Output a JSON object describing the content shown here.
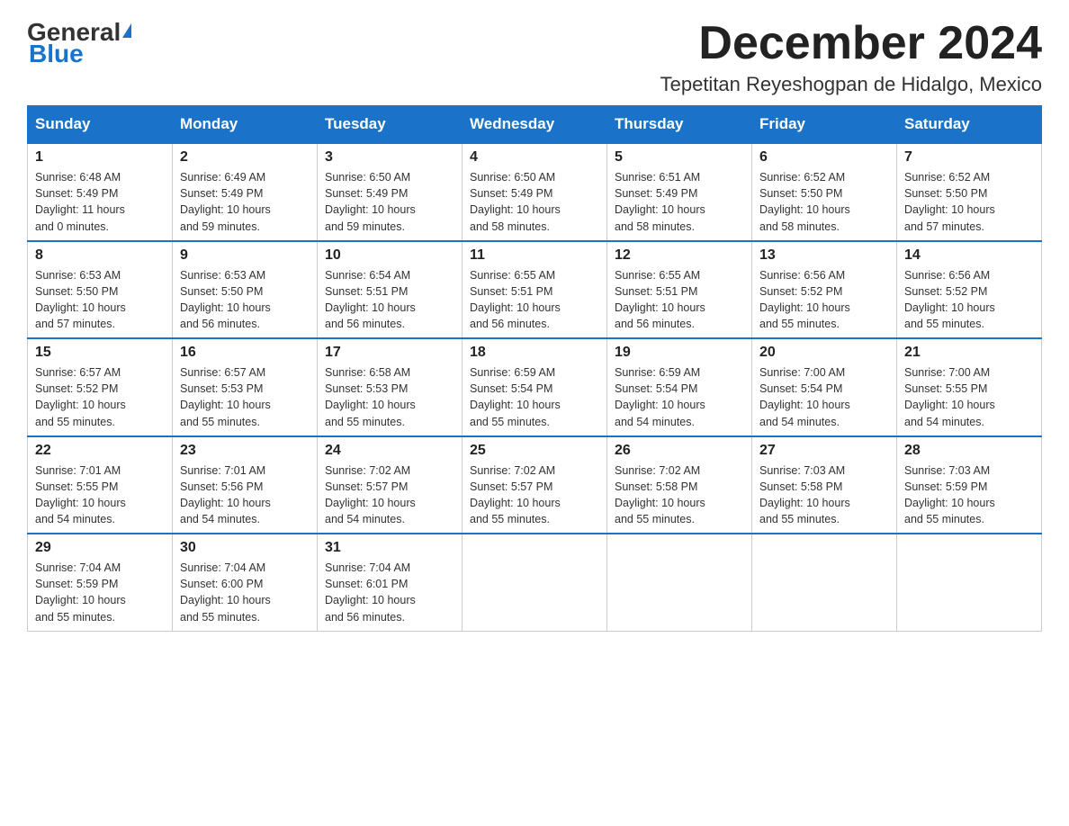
{
  "header": {
    "logo_general": "General",
    "logo_blue": "Blue",
    "month_title": "December 2024",
    "location": "Tepetitan Reyeshogpan de Hidalgo, Mexico"
  },
  "days_of_week": [
    "Sunday",
    "Monday",
    "Tuesday",
    "Wednesday",
    "Thursday",
    "Friday",
    "Saturday"
  ],
  "weeks": [
    [
      {
        "day": "1",
        "sunrise": "6:48 AM",
        "sunset": "5:49 PM",
        "daylight": "11 hours and 0 minutes."
      },
      {
        "day": "2",
        "sunrise": "6:49 AM",
        "sunset": "5:49 PM",
        "daylight": "10 hours and 59 minutes."
      },
      {
        "day": "3",
        "sunrise": "6:50 AM",
        "sunset": "5:49 PM",
        "daylight": "10 hours and 59 minutes."
      },
      {
        "day": "4",
        "sunrise": "6:50 AM",
        "sunset": "5:49 PM",
        "daylight": "10 hours and 58 minutes."
      },
      {
        "day": "5",
        "sunrise": "6:51 AM",
        "sunset": "5:49 PM",
        "daylight": "10 hours and 58 minutes."
      },
      {
        "day": "6",
        "sunrise": "6:52 AM",
        "sunset": "5:50 PM",
        "daylight": "10 hours and 58 minutes."
      },
      {
        "day": "7",
        "sunrise": "6:52 AM",
        "sunset": "5:50 PM",
        "daylight": "10 hours and 57 minutes."
      }
    ],
    [
      {
        "day": "8",
        "sunrise": "6:53 AM",
        "sunset": "5:50 PM",
        "daylight": "10 hours and 57 minutes."
      },
      {
        "day": "9",
        "sunrise": "6:53 AM",
        "sunset": "5:50 PM",
        "daylight": "10 hours and 56 minutes."
      },
      {
        "day": "10",
        "sunrise": "6:54 AM",
        "sunset": "5:51 PM",
        "daylight": "10 hours and 56 minutes."
      },
      {
        "day": "11",
        "sunrise": "6:55 AM",
        "sunset": "5:51 PM",
        "daylight": "10 hours and 56 minutes."
      },
      {
        "day": "12",
        "sunrise": "6:55 AM",
        "sunset": "5:51 PM",
        "daylight": "10 hours and 56 minutes."
      },
      {
        "day": "13",
        "sunrise": "6:56 AM",
        "sunset": "5:52 PM",
        "daylight": "10 hours and 55 minutes."
      },
      {
        "day": "14",
        "sunrise": "6:56 AM",
        "sunset": "5:52 PM",
        "daylight": "10 hours and 55 minutes."
      }
    ],
    [
      {
        "day": "15",
        "sunrise": "6:57 AM",
        "sunset": "5:52 PM",
        "daylight": "10 hours and 55 minutes."
      },
      {
        "day": "16",
        "sunrise": "6:57 AM",
        "sunset": "5:53 PM",
        "daylight": "10 hours and 55 minutes."
      },
      {
        "day": "17",
        "sunrise": "6:58 AM",
        "sunset": "5:53 PM",
        "daylight": "10 hours and 55 minutes."
      },
      {
        "day": "18",
        "sunrise": "6:59 AM",
        "sunset": "5:54 PM",
        "daylight": "10 hours and 55 minutes."
      },
      {
        "day": "19",
        "sunrise": "6:59 AM",
        "sunset": "5:54 PM",
        "daylight": "10 hours and 54 minutes."
      },
      {
        "day": "20",
        "sunrise": "7:00 AM",
        "sunset": "5:54 PM",
        "daylight": "10 hours and 54 minutes."
      },
      {
        "day": "21",
        "sunrise": "7:00 AM",
        "sunset": "5:55 PM",
        "daylight": "10 hours and 54 minutes."
      }
    ],
    [
      {
        "day": "22",
        "sunrise": "7:01 AM",
        "sunset": "5:55 PM",
        "daylight": "10 hours and 54 minutes."
      },
      {
        "day": "23",
        "sunrise": "7:01 AM",
        "sunset": "5:56 PM",
        "daylight": "10 hours and 54 minutes."
      },
      {
        "day": "24",
        "sunrise": "7:02 AM",
        "sunset": "5:57 PM",
        "daylight": "10 hours and 54 minutes."
      },
      {
        "day": "25",
        "sunrise": "7:02 AM",
        "sunset": "5:57 PM",
        "daylight": "10 hours and 55 minutes."
      },
      {
        "day": "26",
        "sunrise": "7:02 AM",
        "sunset": "5:58 PM",
        "daylight": "10 hours and 55 minutes."
      },
      {
        "day": "27",
        "sunrise": "7:03 AM",
        "sunset": "5:58 PM",
        "daylight": "10 hours and 55 minutes."
      },
      {
        "day": "28",
        "sunrise": "7:03 AM",
        "sunset": "5:59 PM",
        "daylight": "10 hours and 55 minutes."
      }
    ],
    [
      {
        "day": "29",
        "sunrise": "7:04 AM",
        "sunset": "5:59 PM",
        "daylight": "10 hours and 55 minutes."
      },
      {
        "day": "30",
        "sunrise": "7:04 AM",
        "sunset": "6:00 PM",
        "daylight": "10 hours and 55 minutes."
      },
      {
        "day": "31",
        "sunrise": "7:04 AM",
        "sunset": "6:01 PM",
        "daylight": "10 hours and 56 minutes."
      },
      null,
      null,
      null,
      null
    ]
  ],
  "labels": {
    "sunrise": "Sunrise:",
    "sunset": "Sunset:",
    "daylight": "Daylight:"
  }
}
